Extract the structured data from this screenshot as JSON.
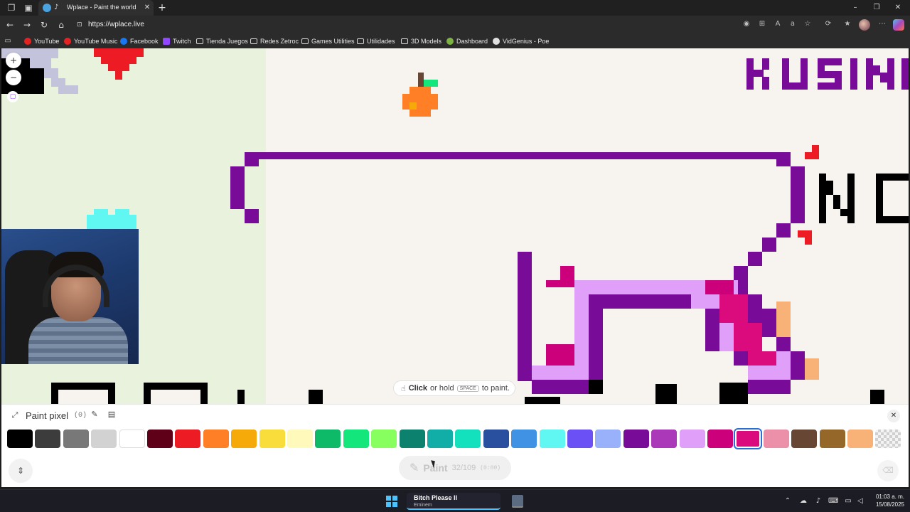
{
  "browser": {
    "tab_title": "Wplace - Paint the world",
    "url": "https://wplace.live",
    "bookmarks": [
      {
        "label": "YouTube",
        "icon": "youtube-icon"
      },
      {
        "label": "YouTube Music",
        "icon": "youtube-music-icon"
      },
      {
        "label": "Facebook",
        "icon": "facebook-icon"
      },
      {
        "label": "Twitch",
        "icon": "twitch-icon"
      },
      {
        "label": "Tienda Juegos",
        "icon": "folder-icon"
      },
      {
        "label": "Redes Zetroc",
        "icon": "folder-icon"
      },
      {
        "label": "Games Utilities",
        "icon": "folder-icon"
      },
      {
        "label": "Utilidades",
        "icon": "folder-icon"
      },
      {
        "label": "3D Models",
        "icon": "folder-icon"
      },
      {
        "label": "Dashboard",
        "icon": "dashboard-icon"
      },
      {
        "label": "VidGenius - Poe",
        "icon": "poe-icon"
      }
    ]
  },
  "canvas": {
    "hint_click": "Click",
    "hint_or_hold": "or hold",
    "hint_key": "SPACE",
    "hint_to_paint": "to paint."
  },
  "panel": {
    "title": "Paint pixel",
    "count": "(0)",
    "paint_label": "Paint",
    "charges": "32/109",
    "timer": "(0:00)",
    "selected_color": "#dc0b7d",
    "palette": [
      "#000000",
      "#3c3c3c",
      "#787878",
      "#d2d2d2",
      "#ffffff",
      "#600018",
      "#ed1c24",
      "#ff7f27",
      "#f6aa09",
      "#f9dd3b",
      "#fffabc",
      "#0eb968",
      "#13e67b",
      "#87ff5e",
      "#0c816e",
      "#10aea6",
      "#13e1be",
      "#28509e",
      "#4093e4",
      "#60f7f2",
      "#6b50f6",
      "#99b1fb",
      "#780c99",
      "#aa38b9",
      "#e09ff9",
      "#cb007a",
      "#dc0b7d",
      "#ec8fa8",
      "#684634",
      "#95682a",
      "#f8b277",
      "transparent"
    ]
  },
  "taskbar": {
    "song_title": "Bitch Please II",
    "song_artist": "Eminem",
    "time": "01:03 a. m.",
    "date": "15/08/2025"
  }
}
